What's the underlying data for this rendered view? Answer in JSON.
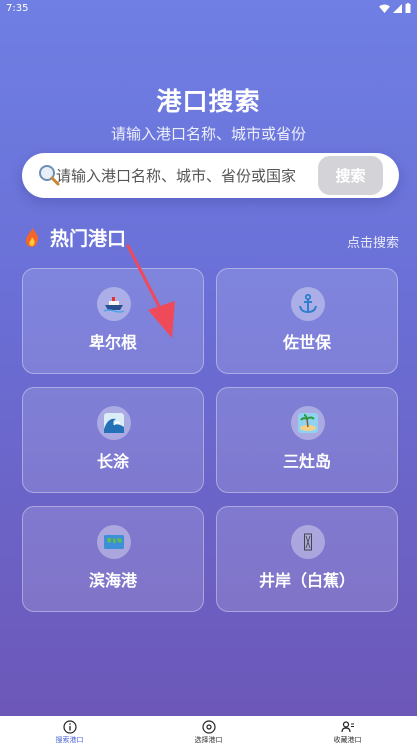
{
  "status_bar": {
    "time": "7:35"
  },
  "header": {
    "title": "港口搜索",
    "subtitle": "请输入港口名称、城市或省份"
  },
  "search": {
    "placeholder": "请输入港口名称、城市、省份或国家",
    "button_label": "搜索"
  },
  "section": {
    "title": "热门港口",
    "action_label": "点击搜索"
  },
  "ports": [
    {
      "name": "卑尔根",
      "icon": "ship-icon"
    },
    {
      "name": "佐世保",
      "icon": "anchor-icon"
    },
    {
      "name": "长涂",
      "icon": "wave-icon"
    },
    {
      "name": "三灶岛",
      "icon": "island-icon"
    },
    {
      "name": "滨海港",
      "icon": "world-map-icon"
    },
    {
      "name": "井岸（白蕉）",
      "icon": "unknown-glyph-icon"
    }
  ],
  "bottom_nav": [
    {
      "label": "搜索港口",
      "active": true
    },
    {
      "label": "选择港口",
      "active": false
    },
    {
      "label": "收藏港口",
      "active": false
    }
  ],
  "colors": {
    "accent": "#4a63d8",
    "arrow": "#ef4a5a",
    "background_top": "#6f7fe3",
    "background_bottom": "#6d56b6"
  }
}
